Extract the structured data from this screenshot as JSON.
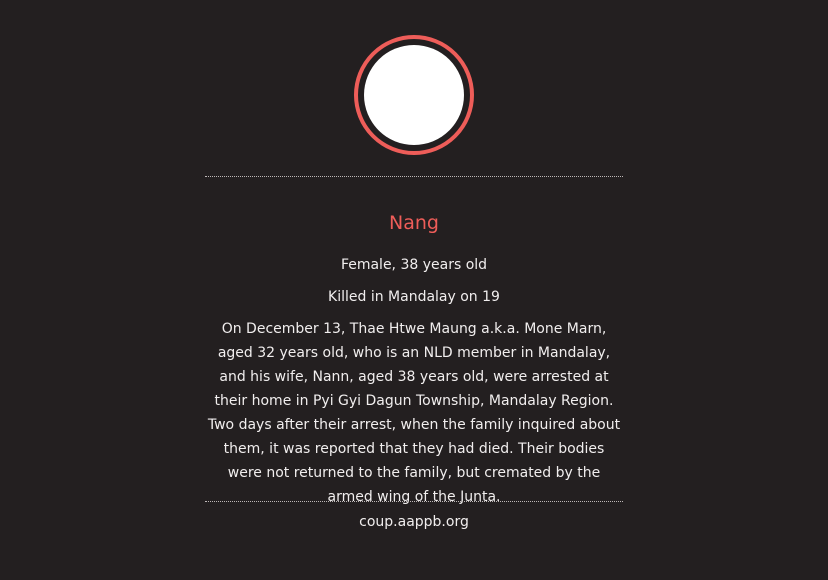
{
  "profile": {
    "name": "Nang",
    "gender_age": "Female, 38 years old",
    "killed": "Killed in Mandalay on 19",
    "story": "On December 13, Thae Htwe Maung a.k.a. Mone Marn, aged 32 years old, who is an NLD member in Mandalay, and his wife, Nann, aged 38 years old, were arrested at their home in Pyi Gyi Dagun Township, Mandalay Region. Two days after their arrest, when the family inquired about them, it was reported that they had died. Their bodies were not returned to the family, but cremated by the armed wing of the Junta.",
    "source": "coup.aappb.org"
  },
  "colors": {
    "background": "#231f20",
    "accent": "#ee5d59",
    "text": "#f1eeee",
    "avatar_fill": "#ffffff",
    "divider": "#bdb7b7"
  }
}
